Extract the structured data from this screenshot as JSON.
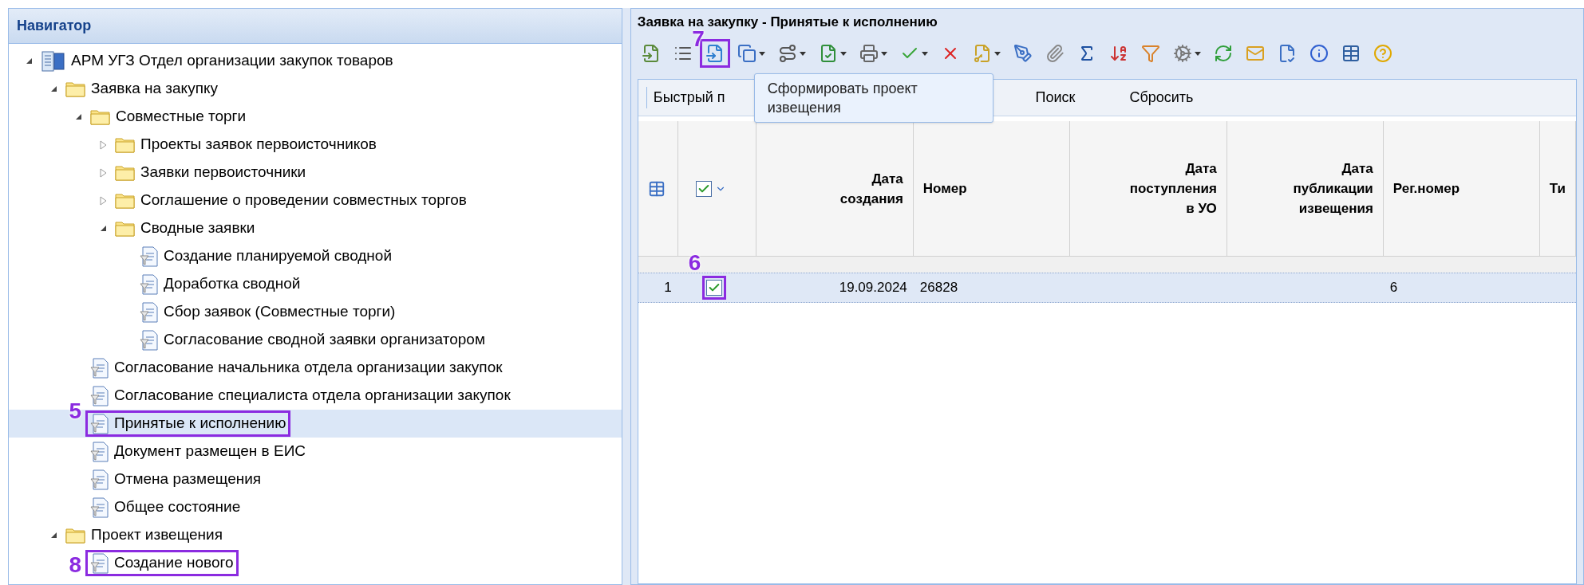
{
  "navigator": {
    "title": "Навигатор",
    "tree": [
      {
        "label": "АРМ УГЗ Отдел организации закупок товаров",
        "kind": "workspace",
        "expanded": true,
        "selected": false,
        "children": [
          {
            "label": "Заявка на закупку",
            "kind": "folder",
            "expanded": true,
            "selected": false,
            "children": [
              {
                "label": "Совместные торги",
                "kind": "folder",
                "expanded": true,
                "selected": false,
                "children": [
                  {
                    "label": "Проекты заявок первоисточников",
                    "kind": "folder",
                    "expanded": false,
                    "selected": false
                  },
                  {
                    "label": "Заявки первоисточники",
                    "kind": "folder",
                    "expanded": false,
                    "selected": false
                  },
                  {
                    "label": "Соглашение о проведении совместных торгов",
                    "kind": "folder",
                    "expanded": false,
                    "selected": false
                  },
                  {
                    "label": "Сводные заявки",
                    "kind": "folder",
                    "expanded": true,
                    "selected": false,
                    "children": [
                      {
                        "label": "Создание планируемой сводной",
                        "kind": "form",
                        "selected": false
                      },
                      {
                        "label": "Доработка сводной",
                        "kind": "form",
                        "selected": false
                      },
                      {
                        "label": "Сбор заявок (Совместные торги)",
                        "kind": "form",
                        "selected": false
                      },
                      {
                        "label": "Согласование сводной заявки организатором",
                        "kind": "form",
                        "selected": false
                      }
                    ]
                  }
                ]
              },
              {
                "label": "Согласование начальника отдела организации закупок",
                "kind": "form",
                "selected": false
              },
              {
                "label": "Согласование специалиста отдела организации закупок",
                "kind": "form",
                "selected": false
              },
              {
                "label": "Принятые к исполнению",
                "kind": "form",
                "selected": true,
                "callout": "5"
              },
              {
                "label": "Документ размещен в ЕИС",
                "kind": "form",
                "selected": false
              },
              {
                "label": "Отмена размещения",
                "kind": "form",
                "selected": false
              },
              {
                "label": "Общее состояние",
                "kind": "form",
                "selected": false
              }
            ]
          },
          {
            "label": "Проект извещения",
            "kind": "folder",
            "expanded": true,
            "selected": false,
            "children": [
              {
                "label": "Создание нового",
                "kind": "form",
                "selected": false,
                "callout": "8"
              }
            ]
          }
        ]
      }
    ]
  },
  "panel": {
    "title": "Заявка на закупку - Принятые к исполнению",
    "toolbar": [
      {
        "dropdown": false
      },
      {
        "dropdown": false
      },
      {
        "dropdown": false,
        "callout": "7"
      },
      {
        "dropdown": true
      },
      {
        "dropdown": true
      },
      {
        "dropdown": true
      },
      {
        "dropdown": true
      },
      {
        "dropdown": true
      },
      {
        "dropdown": false
      },
      {
        "dropdown": true
      },
      {
        "dropdown": false
      },
      {
        "dropdown": false
      },
      {
        "dropdown": false
      },
      {
        "dropdown": false
      },
      {
        "dropdown": false
      },
      {
        "dropdown": true
      },
      {
        "dropdown": false
      },
      {
        "dropdown": false
      },
      {
        "dropdown": false
      },
      {
        "dropdown": false
      },
      {
        "dropdown": false
      },
      {
        "dropdown": false
      }
    ],
    "tooltip": {
      "text": "Сформировать проект извещения"
    },
    "filter_bar": {
      "label": "Быстрый п",
      "buttons": [
        "Поиск",
        "Сбросить"
      ]
    },
    "table": {
      "columns": [
        {
          "kind": "grid"
        },
        {
          "kind": "check",
          "checked": true
        },
        {
          "kind": "text",
          "label": "Дата создания"
        },
        {
          "kind": "text",
          "label": "Номер"
        },
        {
          "kind": "text",
          "label": "Дата поступления в УО"
        },
        {
          "kind": "text",
          "label": "Дата публикации извещения"
        },
        {
          "kind": "text",
          "label": "Рег.номер"
        },
        {
          "kind": "text",
          "label": "Ти"
        }
      ],
      "rows": [
        {
          "number": "1",
          "checked": true,
          "selected": true,
          "callout": "6",
          "cells": [
            "19.09.2024",
            "26828",
            null,
            null,
            "6",
            null
          ]
        }
      ]
    }
  }
}
